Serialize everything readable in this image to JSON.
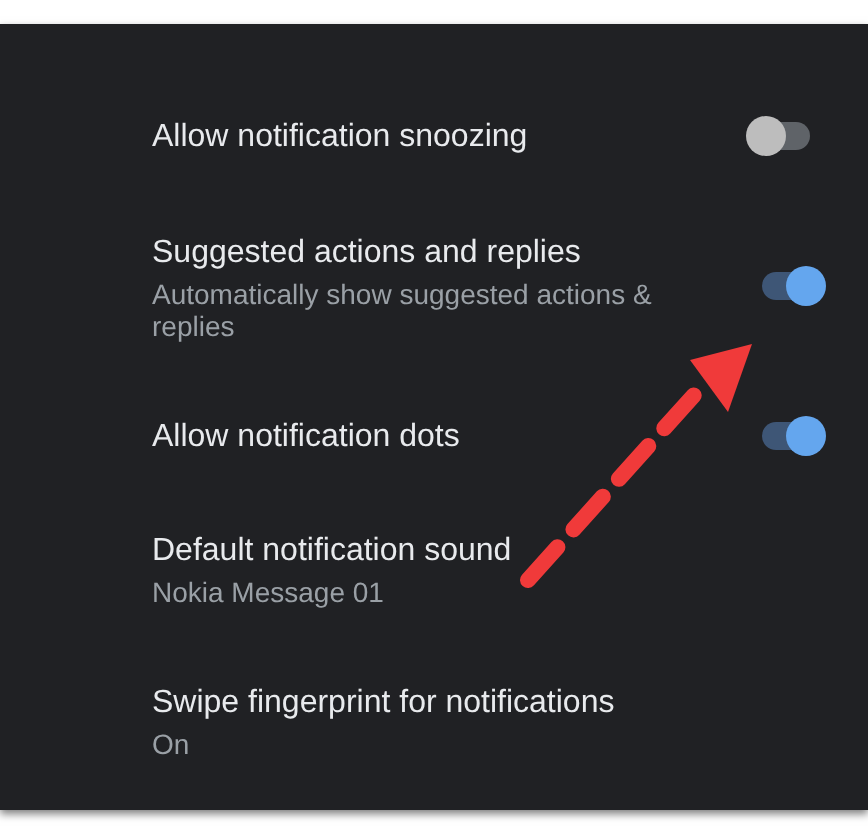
{
  "settings": [
    {
      "kind": "toggle",
      "title": "Allow notification snoozing",
      "checked": false
    },
    {
      "kind": "toggle",
      "title": "Suggested actions and replies",
      "summary": "Automatically show suggested actions & replies",
      "checked": true
    },
    {
      "kind": "toggle",
      "title": "Allow notification dots",
      "checked": true
    },
    {
      "kind": "text",
      "title": "Default notification sound",
      "summary": "Nokia Message 01"
    },
    {
      "kind": "text",
      "title": "Swipe fingerprint for notifications",
      "summary": "On"
    }
  ]
}
